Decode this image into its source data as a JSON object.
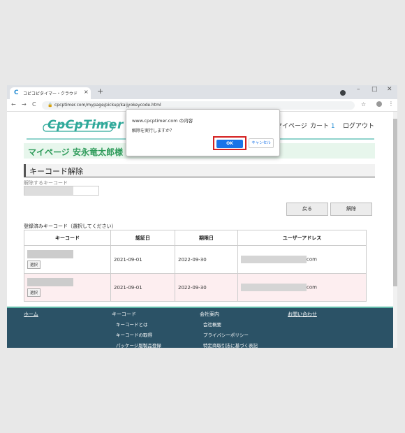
{
  "browser": {
    "tab_icon": "C",
    "tab_title": "コピコピタイマー・クラウド",
    "tab_close": "×",
    "new_tab": "+",
    "window_controls": [
      "–",
      "□",
      "✕"
    ],
    "nav": {
      "back": "←",
      "forward": "→",
      "reload": "C"
    },
    "url": "cpcptimer.com/mypage/pickup/kaijyokeycode.html",
    "lock_icon": "🔒",
    "star_icon": "☆",
    "menu_icon": "⋮"
  },
  "header": {
    "logo_text": "CpCpTimer",
    "nav": {
      "mypage": "マイページ",
      "cart": "カート",
      "cart_count": "1",
      "logout": "ログアウト"
    }
  },
  "banner": {
    "title": "マイページ 安永竜太郎様"
  },
  "section": {
    "title": "キーコード解除"
  },
  "form": {
    "release_label": "解除するキーコード"
  },
  "buttons": {
    "back": "戻る",
    "release": "解除"
  },
  "list": {
    "label": "登録済みキーコード（選択してください）",
    "columns": [
      "キーコード",
      "認証日",
      "期限日",
      "ユーザーアドレス"
    ],
    "select_label": "選択",
    "rows": [
      {
        "auth_date": "2021-09-01",
        "expire_date": "2022-09-30",
        "address_suffix": "com"
      },
      {
        "auth_date": "2021-09-01",
        "expire_date": "2022-09-30",
        "address_suffix": "com"
      }
    ]
  },
  "footer": {
    "home": "ホーム",
    "keycode": {
      "title": "キーコード",
      "links": [
        "キーコードとは",
        "キーコードの取得",
        "パッケージ版製品登録"
      ]
    },
    "company": {
      "title": "会社案内",
      "links": [
        "会社概要",
        "プライバシーポリシー",
        "特定商取引法に基づく表記"
      ]
    },
    "contact": "お問い合わせ"
  },
  "dialog": {
    "origin": "www.cpcptimer.com の内容",
    "message": "解除を実行しますか？",
    "ok": "OK",
    "cancel": "キャンセル"
  },
  "colors": {
    "accent": "#2fa99a",
    "footer_bg": "#2b5266",
    "highlight": "#d42020",
    "ok_blue": "#1a73e8"
  }
}
